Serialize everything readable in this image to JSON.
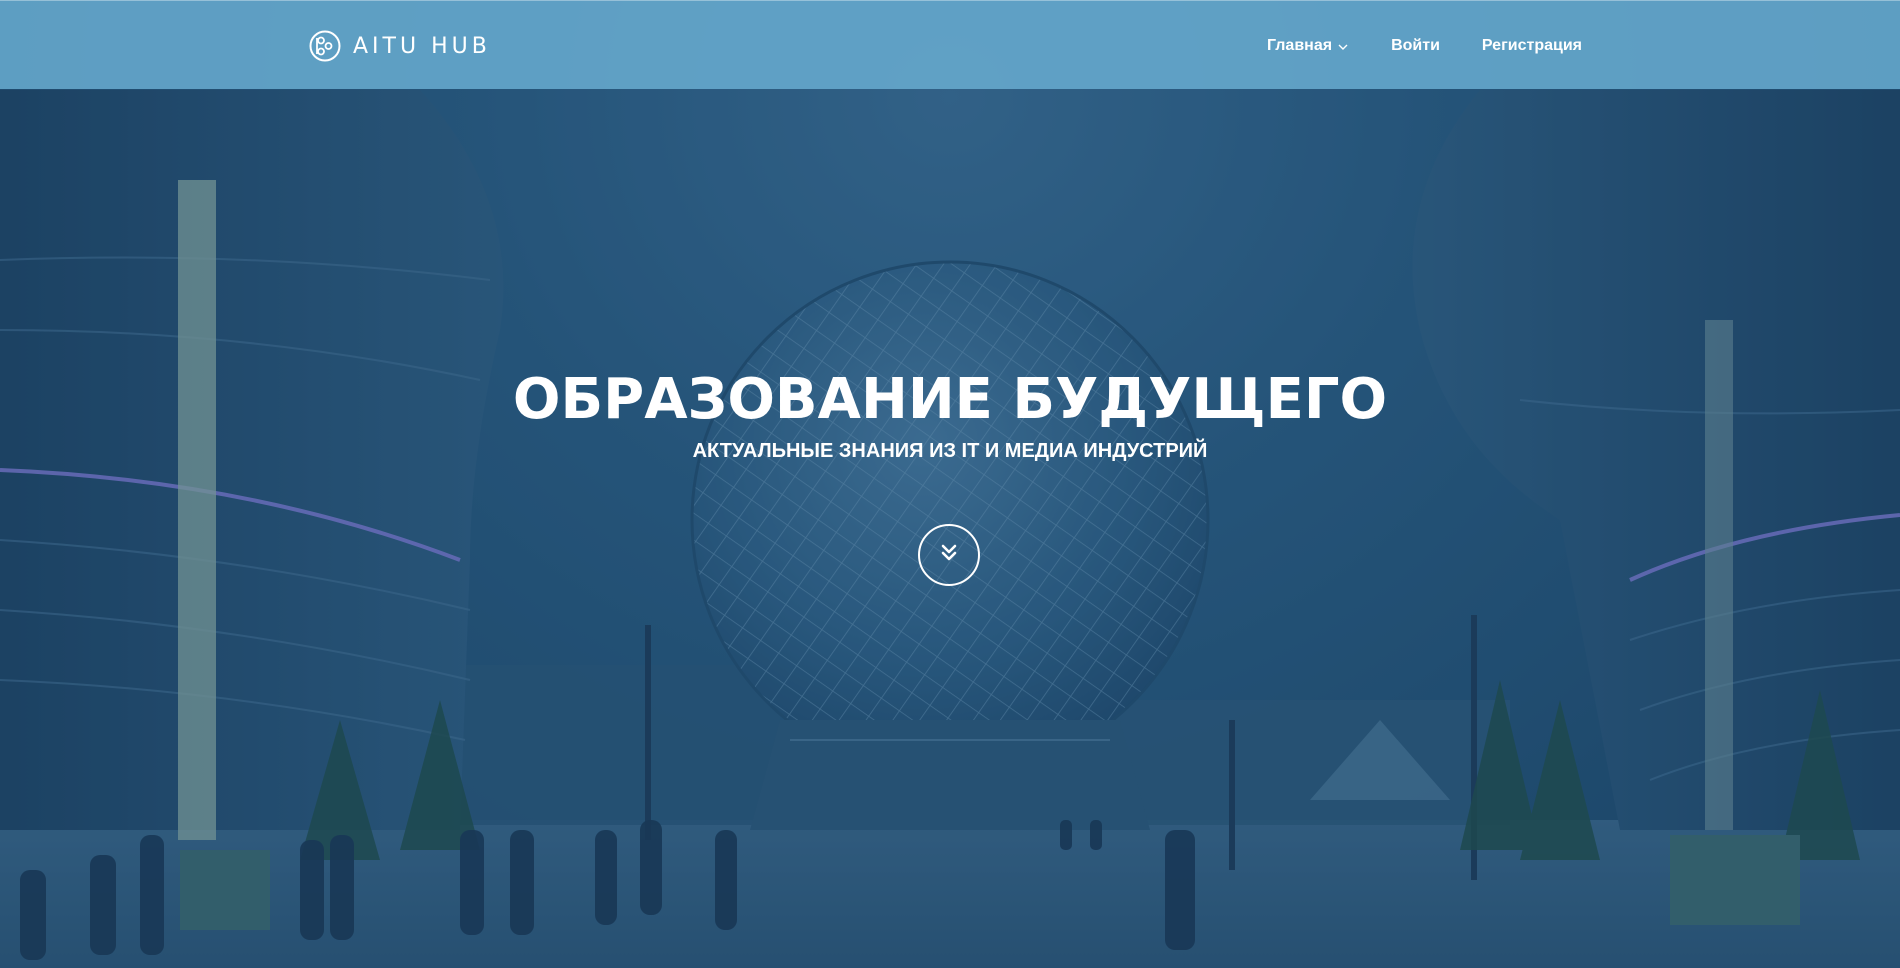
{
  "header": {
    "logo_text": "AITU HUB",
    "logo_icon": "aitu-logo-icon",
    "nav": [
      {
        "label": "Главная",
        "icon": "chevron-down-icon"
      },
      {
        "label": "Войти"
      },
      {
        "label": "Регистрация"
      }
    ]
  },
  "hero": {
    "title": "ОБРАЗОВАНИЕ БУДУЩЕГО",
    "subtitle": "АКТУАЛЬНЫЕ ЗНАНИЯ ИЗ IT И МЕДИА ИНДУСТРИЙ",
    "scroll_icon": "double-chevron-down-icon"
  },
  "colors": {
    "header_bg": "#66AACE",
    "hero_overlay": "#1C486E",
    "text": "#FFFFFF"
  }
}
